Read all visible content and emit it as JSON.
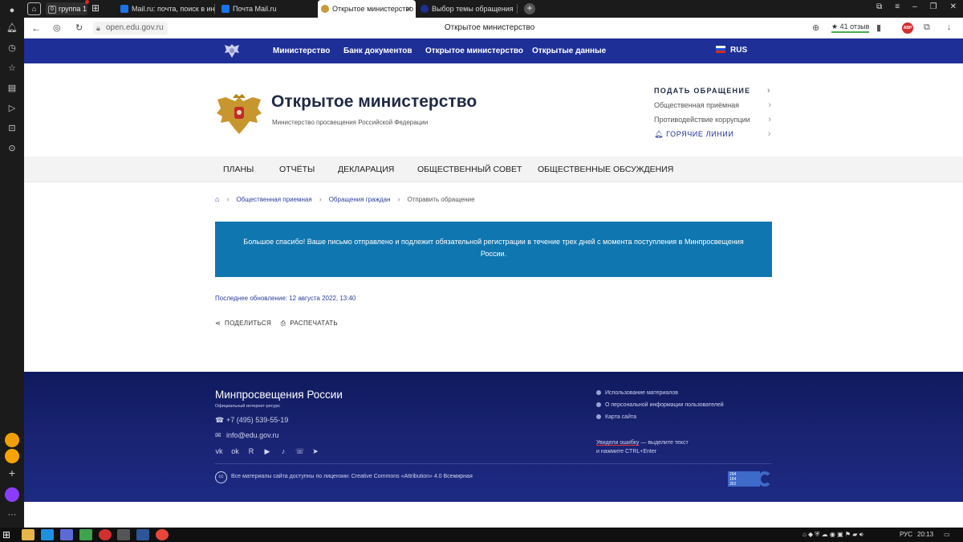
{
  "browser": {
    "tab_group_count": "0",
    "tab_group_label": "группа 1",
    "tabs": [
      {
        "title": "Mail.ru: почта, поиск в ин",
        "color": "#1a73e8"
      },
      {
        "title": "Почта Mail.ru",
        "color": "#1a73e8"
      },
      {
        "title": "Открытое министерство",
        "color": "#c79a3a"
      },
      {
        "title": "Выбор темы обращения",
        "color": "#1e2f97"
      }
    ],
    "url": "open.edu.gov.ru",
    "page_title": "Открытое министерство",
    "reviews": "★ 41 отзыв",
    "abp": "ABP"
  },
  "site": {
    "topnav": {
      "links": [
        "Министерство",
        "Банк документов",
        "Открытое министерство",
        "Открытые данные"
      ],
      "lang": "RUS"
    },
    "header": {
      "title": "Открытое министерство",
      "subtitle": "Министерство просвещения Российской Федерации",
      "quick_links": {
        "submit": "ПОДАТЬ ОБРАЩЕНИЕ",
        "reception": "Общественная приёмная",
        "corruption": "Противодействие коррупции",
        "hotlines": "ГОРЯЧИЕ ЛИНИИ"
      }
    },
    "secnav": [
      "ПЛАНЫ",
      "ОТЧЁТЫ",
      "ДЕКЛАРАЦИЯ",
      "ОБЩЕСТВЕННЫЙ СОВЕТ",
      "ОБЩЕСТВЕННЫЕ ОБСУЖДЕНИЯ"
    ],
    "breadcrumbs": [
      "Общественная приемная",
      "Обращения граждан",
      "Отправить обращение"
    ],
    "notice": "Большое спасибо! Ваше письмо отправлено и подлежит обязательной регистрации в течение трех дней с момента поступления в Минпросвещения России.",
    "updated": "Последнее обновление: 12 августа 2022, 13:40",
    "actions": {
      "share": "ПОДЕЛИТЬСЯ",
      "print": "РАСПЕЧАТАТЬ"
    },
    "footer": {
      "org": "Минпросвещения России",
      "org_sub": "Официальный интернет-ресурс",
      "phone": "+7 (495) 539-55-19",
      "email": "info@edu.gov.ru",
      "links": [
        "Использование материалов",
        "О персональной информации пользователей",
        "Карта сайта"
      ],
      "typo_link": "Увидели ошибку",
      "typo_rest": " — выделите текст",
      "typo_line2": "и нажмите CTRL+Enter",
      "license": "Все материалы сайта доступны по лицензии: Creative Commons «Attribution» 4.0 Всемирная",
      "cc": "cc",
      "counter": [
        "294",
        "164",
        "352"
      ]
    }
  },
  "taskbar": {
    "lang": "РУС",
    "time": "20:13"
  },
  "colors": {
    "brand_blue": "#1e2f97",
    "notice_blue": "#0f76b0",
    "footer_navy": "#1b2576"
  }
}
